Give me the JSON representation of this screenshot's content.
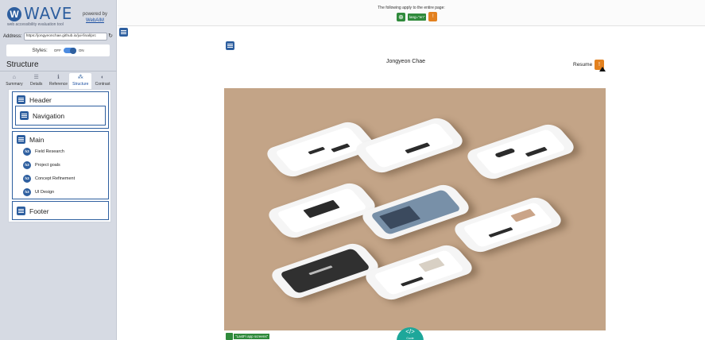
{
  "wave": {
    "logo_letter": "W",
    "logo_word": "WAVE",
    "logo_tag": "web accessibility evaluation tool",
    "powered_by": "powered by",
    "powered_link": "WebAIM",
    "address_label": "Address:",
    "address_value": "https://jongyeonchae.github.io/jui-final/prc",
    "styles_label": "Styles:",
    "styles_off": "OFF",
    "styles_on": "ON",
    "section_title": "Structure",
    "tabs": [
      {
        "label": "Summary",
        "icon": "home-icon",
        "glyph": "⌂"
      },
      {
        "label": "Details",
        "icon": "list-icon",
        "glyph": "☰"
      },
      {
        "label": "Reference",
        "icon": "info-icon",
        "glyph": "ℹ"
      },
      {
        "label": "Structure",
        "icon": "structure-icon",
        "glyph": "⁂"
      },
      {
        "label": "Contrast",
        "icon": "contrast-icon",
        "glyph": "◐"
      }
    ],
    "active_tab": "Structure",
    "structure": {
      "header": "Header",
      "navigation": "Navigation",
      "main": "Main",
      "headings": [
        {
          "level": "h3",
          "text": "Field Research"
        },
        {
          "level": "h3",
          "text": "Project goals"
        },
        {
          "level": "h3",
          "text": "Concept Refinement"
        },
        {
          "level": "h3",
          "text": "UI Design"
        }
      ],
      "footer": "Footer"
    }
  },
  "topbar": {
    "message": "The following apply to the entire page:",
    "lang_badge": "lang=\"en\""
  },
  "page": {
    "site_title": "Jongyeon Chae",
    "resume": "Resume",
    "alt_text": "\"LastFi app screens\"",
    "code_button": "</>",
    "code_button_sub": "Code"
  },
  "colors": {
    "wave_blue": "#2e5f9f",
    "sidebar_bg": "#d6dae3",
    "feature_green": "#2f8a3b",
    "alert_orange": "#e3811f",
    "hero_bg": "#c3a487",
    "code_teal": "#1ea79a"
  }
}
